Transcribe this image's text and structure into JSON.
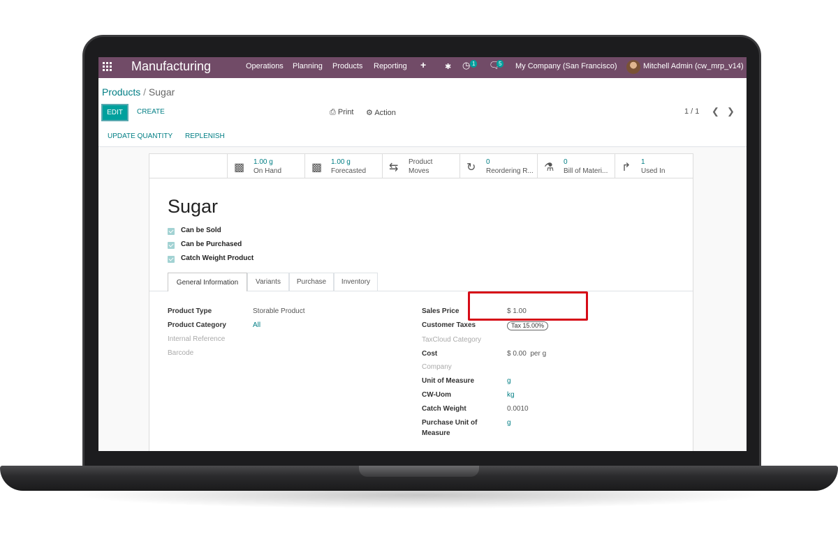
{
  "navbar": {
    "app_name": "Manufacturing",
    "menu": [
      "Operations",
      "Planning",
      "Products",
      "Reporting"
    ],
    "plus_icon": "+",
    "bug_icon": "✱",
    "activity_count": "1",
    "message_count": "5",
    "company": "My Company (San Francisco)",
    "user": "Mitchell Admin (cw_mrp_v14)",
    "color": "#714b67"
  },
  "breadcrumb": {
    "parent": "Products",
    "separator": "/",
    "current": "Sugar"
  },
  "toolbar": {
    "edit_label": "EDIT",
    "create_label": "CREATE",
    "print_label": "Print",
    "action_label": "Action",
    "pager": "1 / 1"
  },
  "statusbar": {
    "update_quantity": "UPDATE QUANTITY",
    "replenish": "REPLENISH"
  },
  "smart_buttons": [
    {
      "icon": "cubes-icon",
      "value": "1.00 g",
      "label": "On Hand"
    },
    {
      "icon": "cubes-icon",
      "value": "1.00 g",
      "label": "Forecasted"
    },
    {
      "icon": "exchange-icon",
      "value": "Product",
      "label": "Moves"
    },
    {
      "icon": "refresh-icon",
      "value": "0",
      "label": "Reordering R..."
    },
    {
      "icon": "flask-icon",
      "value": "0",
      "label": "Bill of Materi..."
    },
    {
      "icon": "level-up-icon",
      "value": "1",
      "label": "Used In"
    }
  ],
  "product": {
    "name": "Sugar",
    "checkboxes": [
      "Can be Sold",
      "Can be Purchased",
      "Catch Weight Product"
    ]
  },
  "tabs": [
    "General Information",
    "Variants",
    "Purchase",
    "Inventory"
  ],
  "left_fields": {
    "product_type_label": "Product Type",
    "product_type_value": "Storable Product",
    "product_category_label": "Product Category",
    "product_category_value": "All",
    "internal_reference_label": "Internal Reference",
    "barcode_label": "Barcode"
  },
  "right_fields": {
    "sales_price_label": "Sales Price",
    "sales_price_value": "$ 1.00",
    "customer_taxes_label": "Customer Taxes",
    "customer_taxes_value": "Tax 15.00%",
    "taxcloud_label": "TaxCloud Category",
    "cost_label": "Cost",
    "cost_value": "$ 0.00  per g",
    "company_label": "Company",
    "uom_label": "Unit of Measure",
    "uom_value": "g",
    "cw_uom_label": "CW-Uom",
    "cw_uom_value": "kg",
    "catch_weight_label": "Catch Weight",
    "catch_weight_value": "0.0010",
    "purchase_uom_label_1": "Purchase Unit of",
    "purchase_uom_label_2": "Measure",
    "purchase_uom_value": "g"
  },
  "accent_color": "#017e84",
  "highlight_color": "#d60b17"
}
